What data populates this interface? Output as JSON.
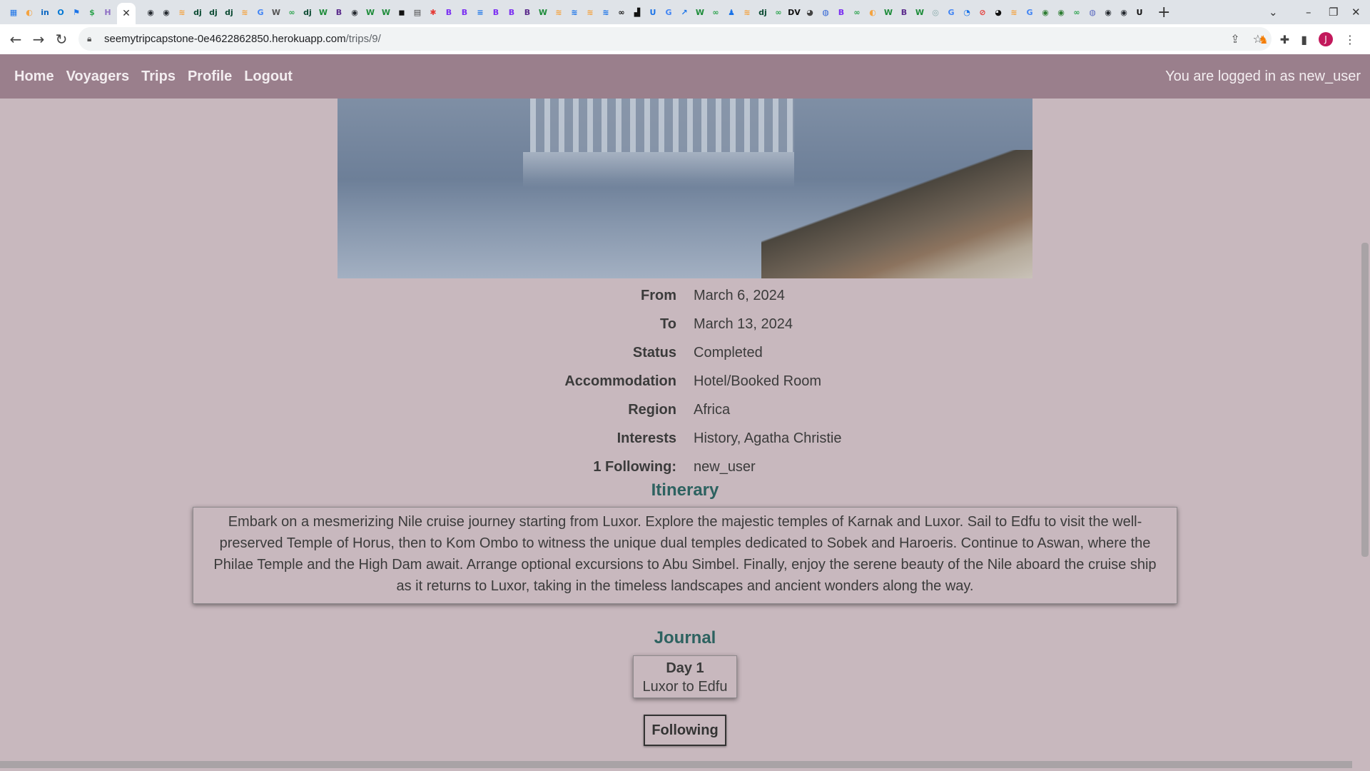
{
  "browser": {
    "tab_icons": [
      {
        "glyph": "▦",
        "color": "#1a73e8"
      },
      {
        "glyph": "◐",
        "color": "#f4a340"
      },
      {
        "glyph": "in",
        "color": "#0a66c2"
      },
      {
        "glyph": "O",
        "color": "#0078d4"
      },
      {
        "glyph": "⚑",
        "color": "#1a73e8"
      },
      {
        "glyph": "$",
        "color": "#2ea44f"
      },
      {
        "glyph": "H",
        "color": "#8e6fc4"
      }
    ],
    "tab_icons_more": [
      {
        "glyph": "◉",
        "color": "#24292f"
      },
      {
        "glyph": "◉",
        "color": "#24292f"
      },
      {
        "glyph": "≋",
        "color": "#f4a340"
      },
      {
        "glyph": "dj",
        "color": "#0c4b33"
      },
      {
        "glyph": "dj",
        "color": "#0c4b33"
      },
      {
        "glyph": "dj",
        "color": "#0c4b33"
      },
      {
        "glyph": "≋",
        "color": "#f4a340"
      },
      {
        "glyph": "G",
        "color": "#4285f4"
      },
      {
        "glyph": "W",
        "color": "#555555"
      },
      {
        "glyph": "∞",
        "color": "#2ea44f"
      },
      {
        "glyph": "dj",
        "color": "#0c4b33"
      },
      {
        "glyph": "W",
        "color": "#1e8c3a"
      },
      {
        "glyph": "B",
        "color": "#5b2a8c"
      },
      {
        "glyph": "◉",
        "color": "#24292f"
      },
      {
        "glyph": "W",
        "color": "#1e8c3a"
      },
      {
        "glyph": "W",
        "color": "#1e8c3a"
      },
      {
        "glyph": "◼",
        "color": "#111111"
      },
      {
        "glyph": "▤",
        "color": "#444444"
      },
      {
        "glyph": "✱",
        "color": "#e53935"
      },
      {
        "glyph": "B",
        "color": "#7b2ff2"
      },
      {
        "glyph": "B",
        "color": "#7b2ff2"
      },
      {
        "glyph": "≡",
        "color": "#1a73e8"
      },
      {
        "glyph": "B",
        "color": "#7b2ff2"
      },
      {
        "glyph": "B",
        "color": "#7b2ff2"
      },
      {
        "glyph": "B",
        "color": "#5b2a8c"
      },
      {
        "glyph": "W",
        "color": "#1e8c3a"
      },
      {
        "glyph": "≋",
        "color": "#f4a340"
      },
      {
        "glyph": "≋",
        "color": "#1a73e8"
      },
      {
        "glyph": "≋",
        "color": "#f4a340"
      },
      {
        "glyph": "≋",
        "color": "#1a73e8"
      },
      {
        "glyph": "∞",
        "color": "#111111"
      },
      {
        "glyph": "▟",
        "color": "#111111"
      },
      {
        "glyph": "U",
        "color": "#1a73e8"
      },
      {
        "glyph": "G",
        "color": "#4285f4"
      },
      {
        "glyph": "↗",
        "color": "#1a73e8"
      },
      {
        "glyph": "W",
        "color": "#1e8c3a"
      },
      {
        "glyph": "∞",
        "color": "#2ea44f"
      },
      {
        "glyph": "♟",
        "color": "#1a73e8"
      },
      {
        "glyph": "≋",
        "color": "#f4a340"
      },
      {
        "glyph": "dj",
        "color": "#0c4b33"
      },
      {
        "glyph": "∞",
        "color": "#2ea44f"
      },
      {
        "glyph": "DV",
        "color": "#111111"
      },
      {
        "glyph": "◕",
        "color": "#444444"
      },
      {
        "glyph": "◍",
        "color": "#3367d6"
      },
      {
        "glyph": "B",
        "color": "#7b2ff2"
      },
      {
        "glyph": "∞",
        "color": "#2ea44f"
      },
      {
        "glyph": "◐",
        "color": "#f4a340"
      },
      {
        "glyph": "W",
        "color": "#1e8c3a"
      },
      {
        "glyph": "B",
        "color": "#5b2a8c"
      },
      {
        "glyph": "W",
        "color": "#1e8c3a"
      },
      {
        "glyph": "◎",
        "color": "#8aa"
      },
      {
        "glyph": "G",
        "color": "#4285f4"
      },
      {
        "glyph": "◔",
        "color": "#1a73e8"
      },
      {
        "glyph": "⊘",
        "color": "#e53935"
      },
      {
        "glyph": "◕",
        "color": "#111111"
      },
      {
        "glyph": "≋",
        "color": "#f4a340"
      },
      {
        "glyph": "G",
        "color": "#4285f4"
      },
      {
        "glyph": "◉",
        "color": "#2e7d32"
      },
      {
        "glyph": "◉",
        "color": "#2e7d32"
      },
      {
        "glyph": "∞",
        "color": "#2ea44f"
      },
      {
        "glyph": "◍",
        "color": "#5c6bc0"
      },
      {
        "glyph": "◉",
        "color": "#24292f"
      },
      {
        "glyph": "◉",
        "color": "#24292f"
      },
      {
        "glyph": "U",
        "color": "#111111"
      }
    ],
    "url_host": "seemytripcapstone-0e4622862850.herokuapp.com",
    "url_path": "/trips/9/",
    "profile_initial": "J"
  },
  "nav": {
    "links": [
      "Home",
      "Voyagers",
      "Trips",
      "Profile",
      "Logout"
    ],
    "login_status": "You are logged in as new_user"
  },
  "trip": {
    "details": [
      {
        "label": "From",
        "value": "March 6, 2024"
      },
      {
        "label": "To",
        "value": "March 13, 2024"
      },
      {
        "label": "Status",
        "value": "Completed"
      },
      {
        "label": "Accommodation",
        "value": "Hotel/Booked Room"
      },
      {
        "label": "Region",
        "value": "Africa"
      },
      {
        "label": "Interests",
        "value": "History, Agatha Christie"
      },
      {
        "label": "1 Following:",
        "value": "new_user"
      }
    ],
    "itinerary_heading": "Itinerary",
    "itinerary_text": "Embark on a mesmerizing Nile cruise journey starting from Luxor. Explore the majestic temples of Karnak and Luxor. Sail to Edfu to visit the well-preserved Temple of Horus, then to Kom Ombo to witness the unique dual temples dedicated to Sobek and Haroeris. Continue to Aswan, where the Philae Temple and the High Dam await. Arrange optional excursions to Abu Simbel. Finally, enjoy the serene beauty of the Nile aboard the cruise ship as it returns to Luxor, taking in the timeless landscapes and ancient wonders along the way.",
    "journal_heading": "Journal",
    "journal_entries": [
      {
        "day": "Day 1",
        "title": "Luxor to Edfu"
      }
    ],
    "follow_button": "Following"
  },
  "colors": {
    "page_bg": "#c8b8be",
    "navbar_bg": "#9a7f8c",
    "heading": "#2d6260"
  }
}
